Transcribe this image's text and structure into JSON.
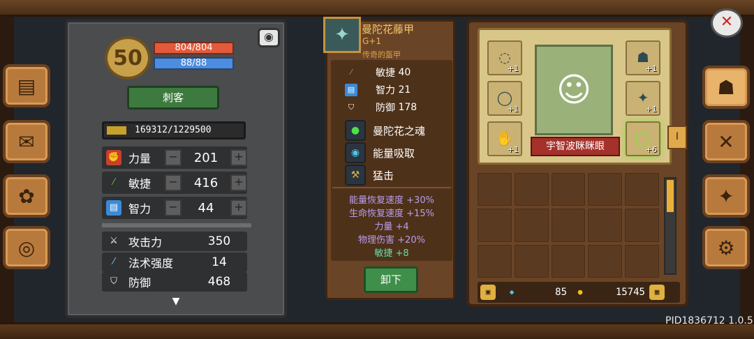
{
  "player": {
    "level": "50",
    "hp": "804/804",
    "mp": "88/88",
    "class_label": "刺客",
    "xp": "169312/1229500"
  },
  "stats": [
    {
      "icon": "fist-icon",
      "label": "力量",
      "value": "201"
    },
    {
      "icon": "feather-icon",
      "label": "敏捷",
      "value": "416"
    },
    {
      "icon": "book-icon",
      "label": "智力",
      "value": "44"
    }
  ],
  "attributes": [
    {
      "icon": "sword-icon",
      "label": "攻击力",
      "value": "350"
    },
    {
      "icon": "wand-icon",
      "label": "法术强度",
      "value": "14"
    },
    {
      "icon": "shield-icon",
      "label": "防御",
      "value": "468"
    }
  ],
  "item": {
    "name": "曼陀花藤甲",
    "grade": "G+1",
    "rarity": "传奇的盔甲",
    "stats": [
      {
        "label": "敏捷",
        "value": "40"
      },
      {
        "label": "智力",
        "value": "21"
      },
      {
        "label": "防御",
        "value": "178"
      }
    ],
    "skills": [
      "曼陀花之魂",
      "能量吸取",
      "猛击"
    ],
    "bonuses": [
      "能量恢复速度 +30%",
      "生命恢复速度 +15%",
      "力量 +4",
      "物理伤害 +20%"
    ],
    "bonus_highlight": "敏捷 +8",
    "unequip_label": "卸下"
  },
  "equipment": {
    "character_name": "宇智波眯眯眼",
    "slot_levels": [
      "+1",
      "+1",
      "+1",
      "+1",
      "+1",
      "+6"
    ],
    "page_tab": "I"
  },
  "currency": {
    "gems": "85",
    "gold": "15745"
  },
  "version": "PID1836712 1.0.5",
  "colors": {
    "hp": "#e35a3a",
    "mp": "#4d8de0",
    "accent_gold": "#e8b038",
    "bonus_purple": "#b99ef0",
    "bonus_green": "#5fe0a8"
  }
}
